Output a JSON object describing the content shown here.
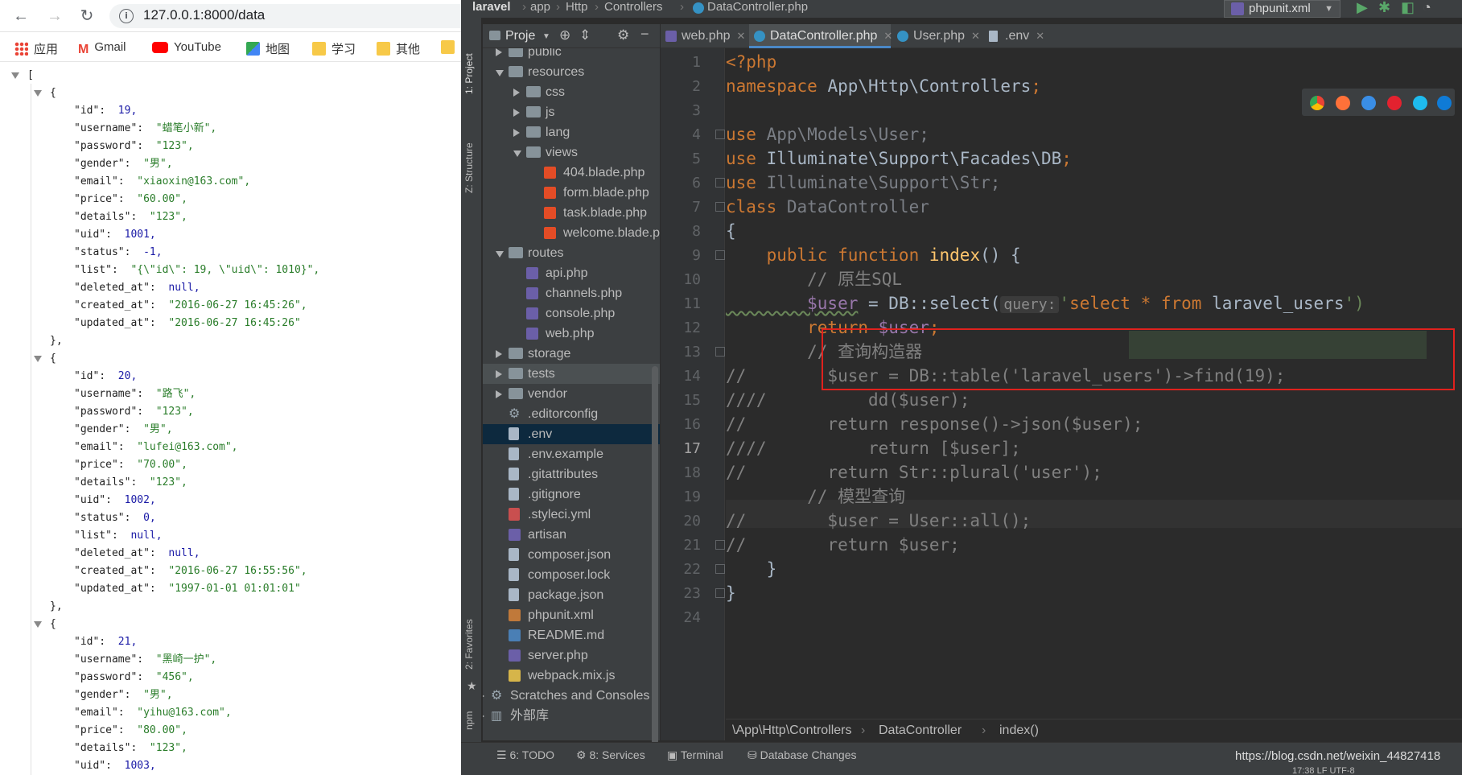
{
  "browser": {
    "url": "127.0.0.1:8000/data",
    "bookmarks": [
      {
        "label": "应用",
        "icon": "apps-grid-icon"
      },
      {
        "label": "Gmail",
        "icon": "gmail-icon"
      },
      {
        "label": "YouTube",
        "icon": "youtube-icon"
      },
      {
        "label": "地图",
        "icon": "maps-icon"
      },
      {
        "label": "学习",
        "icon": "folder-icon"
      },
      {
        "label": "其他",
        "icon": "folder-icon"
      }
    ],
    "json_lines": [
      "[",
      "{",
      "\"id\":  19,",
      "\"username\":  \"蜡笔小新\",",
      "\"password\":  \"123\",",
      "\"gender\":  \"男\",",
      "\"email\":  \"xiaoxin@163.com\",",
      "\"price\":  \"60.00\",",
      "\"details\":  \"123\",",
      "\"uid\":  1001,",
      "\"status\":  -1,",
      "\"list\":  \"{\\\"id\\\": 19, \\\"uid\\\": 1010}\",",
      "\"deleted_at\":  null,",
      "\"created_at\":  \"2016-06-27 16:45:26\",",
      "\"updated_at\":  \"2016-06-27 16:45:26\"",
      "},",
      "{",
      "\"id\":  20,",
      "\"username\":  \"路飞\",",
      "\"password\":  \"123\",",
      "\"gender\":  \"男\",",
      "\"email\":  \"lufei@163.com\",",
      "\"price\":  \"70.00\",",
      "\"details\":  \"123\",",
      "\"uid\":  1002,",
      "\"status\":  0,",
      "\"list\":  null,",
      "\"deleted_at\":  null,",
      "\"created_at\":  \"2016-06-27 16:55:56\",",
      "\"updated_at\":  \"1997-01-01 01:01:01\"",
      "},",
      "{",
      "\"id\":  21,",
      "\"username\":  \"黑崎一护\",",
      "\"password\":  \"456\",",
      "\"gender\":  \"男\",",
      "\"email\":  \"yihu@163.com\",",
      "\"price\":  \"80.00\",",
      "\"details\":  \"123\",",
      "\"uid\":  1003,"
    ]
  },
  "ide": {
    "nav_crumbs": [
      "laravel",
      "app",
      "Http",
      "Controllers",
      "DataController.php"
    ],
    "run_config": "phpunit.xml",
    "side_tabs": [
      "1: Project",
      "Z: Structure",
      "2: Favorites",
      "npm"
    ],
    "project_tab": "Proje",
    "tree": [
      {
        "label": "public",
        "kind": "dir",
        "arrow": "r"
      },
      {
        "label": "resources",
        "kind": "dir",
        "arrow": "d"
      },
      {
        "label": "css",
        "kind": "dir",
        "arrow": "r"
      },
      {
        "label": "js",
        "kind": "dir",
        "arrow": "r"
      },
      {
        "label": "lang",
        "kind": "dir",
        "arrow": "r"
      },
      {
        "label": "views",
        "kind": "dir",
        "arrow": "d"
      },
      {
        "label": "404.blade.php",
        "kind": "blade",
        "arrow": ""
      },
      {
        "label": "form.blade.php",
        "kind": "blade",
        "arrow": ""
      },
      {
        "label": "task.blade.php",
        "kind": "blade",
        "arrow": ""
      },
      {
        "label": "welcome.blade.p",
        "kind": "blade",
        "arrow": ""
      },
      {
        "label": "routes",
        "kind": "dir",
        "arrow": "d"
      },
      {
        "label": "api.php",
        "kind": "php",
        "arrow": ""
      },
      {
        "label": "channels.php",
        "kind": "php",
        "arrow": ""
      },
      {
        "label": "console.php",
        "kind": "php",
        "arrow": ""
      },
      {
        "label": "web.php",
        "kind": "php",
        "arrow": ""
      },
      {
        "label": "storage",
        "kind": "dir",
        "arrow": "r"
      },
      {
        "label": "tests",
        "kind": "dir",
        "arrow": "r"
      },
      {
        "label": "vendor",
        "kind": "dir",
        "arrow": "r"
      },
      {
        "label": ".editorconfig",
        "kind": "gear",
        "arrow": ""
      },
      {
        "label": ".env",
        "kind": "file",
        "arrow": ""
      },
      {
        "label": ".env.example",
        "kind": "file",
        "arrow": ""
      },
      {
        "label": ".gitattributes",
        "kind": "file",
        "arrow": ""
      },
      {
        "label": ".gitignore",
        "kind": "file",
        "arrow": ""
      },
      {
        "label": ".styleci.yml",
        "kind": "yml",
        "arrow": ""
      },
      {
        "label": "artisan",
        "kind": "php",
        "arrow": ""
      },
      {
        "label": "composer.json",
        "kind": "json",
        "arrow": ""
      },
      {
        "label": "composer.lock",
        "kind": "file",
        "arrow": ""
      },
      {
        "label": "package.json",
        "kind": "json",
        "arrow": ""
      },
      {
        "label": "phpunit.xml",
        "kind": "xml",
        "arrow": ""
      },
      {
        "label": "README.md",
        "kind": "md",
        "arrow": ""
      },
      {
        "label": "server.php",
        "kind": "php",
        "arrow": ""
      },
      {
        "label": "webpack.mix.js",
        "kind": "js",
        "arrow": ""
      },
      {
        "label": "Scratches and Consoles",
        "kind": "gear",
        "arrow": "r"
      },
      {
        "label": "外部库",
        "kind": "lib",
        "arrow": "r"
      }
    ],
    "tabs": [
      {
        "label": "web.php",
        "active": false
      },
      {
        "label": "DataController.php",
        "active": true
      },
      {
        "label": "User.php",
        "active": false
      },
      {
        "label": ".env",
        "active": false
      }
    ],
    "line_numbers": [
      "1",
      "2",
      "3",
      "4",
      "5",
      "6",
      "7",
      "8",
      "9",
      "10",
      "11",
      "12",
      "13",
      "14",
      "15",
      "16",
      "17",
      "18",
      "19",
      "20",
      "21",
      "22",
      "23",
      "24"
    ],
    "current_line": "17",
    "code": {
      "l1": "<?php",
      "l2_kw": "namespace",
      "l2_ns": " App\\Http\\Controllers",
      "l4_kw": "use",
      "l4_ns": " App\\Models\\User;",
      "l5_kw": "use",
      "l5_ns": " Illuminate\\Support\\Facades\\DB",
      "l6_kw": "use",
      "l6_ns": " Illuminate\\Support\\Str;",
      "l7_kw": "class",
      "l7_ns": " DataController",
      "l8": "{",
      "l9_kw": "    public function ",
      "l9_fn": "index",
      "l9_rest": "() {",
      "l10": "        // 原生SQL",
      "l11_var": "        $user",
      "l11_mid": " = DB::select(",
      "l11_hint": "query:",
      "l11_q": "'",
      "l11_sql1": "select",
      "l11_sql2": " * ",
      "l11_sql3": "from",
      "l11_sql4": " laravel_users",
      "l11_end": "')",
      "l12_kw": "        return ",
      "l12_var": "$user",
      "l12_end": ";",
      "l13": "        // 查询构造器",
      "l14": "//        $user = DB::table('laravel_users')->find(19);",
      "l15": "////          dd($user);",
      "l16": "//        return response()->json($user);",
      "l17": "////          return [$user];",
      "l18": "//        return Str::plural('user');",
      "l19": "        // 模型查询",
      "l20": "//        $user = User::all();",
      "l21": "//        return $user;",
      "l22": "    }",
      "l23": "}"
    },
    "breadcrumb": [
      "\\App\\Http\\Controllers",
      "DataController",
      "index()"
    ],
    "bottom_tabs": [
      "6: TODO",
      "8: Services",
      "Terminal",
      "Database Changes"
    ],
    "watermark": "https://blog.csdn.net/weixin_44827418",
    "status_text": "17:38   LF   UTF-8"
  }
}
